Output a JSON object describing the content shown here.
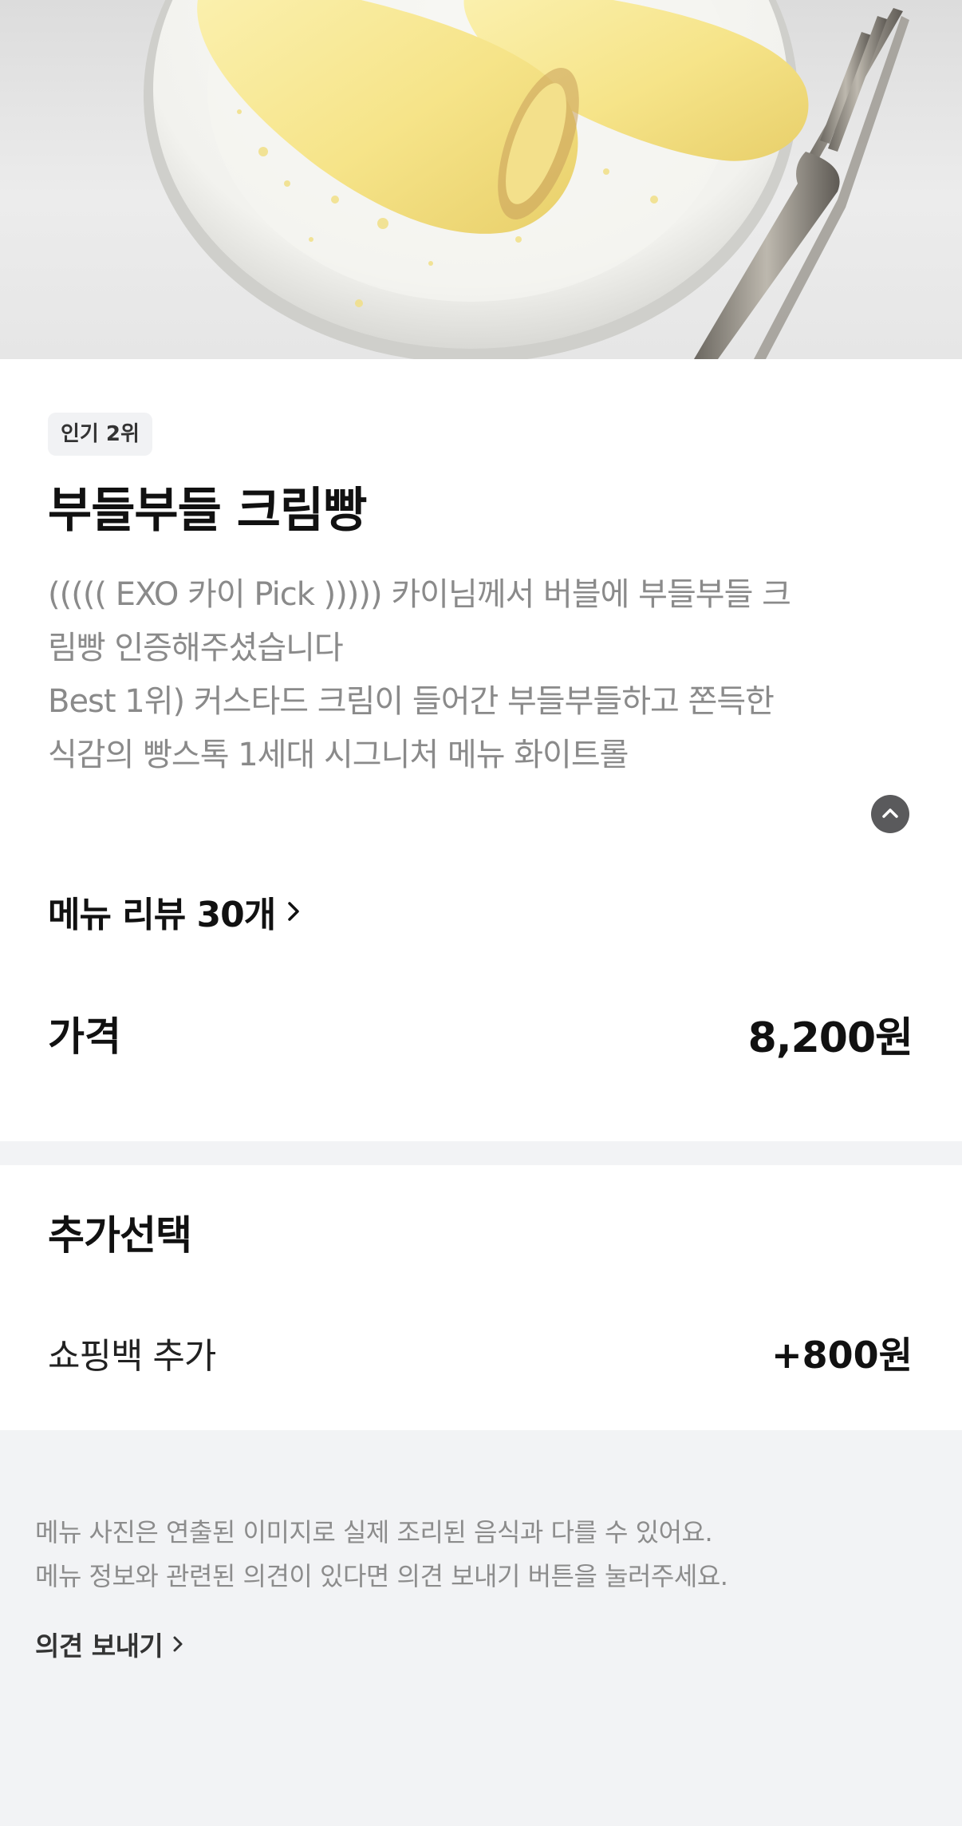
{
  "hero": {
    "image": "cream-bread-photo"
  },
  "menu": {
    "badge": "인기 2위",
    "title": "부들부들 크림빵",
    "description_lines": [
      "((((( EXO 카이 Pick ))))) 카이님께서 버블에 부들부들 크",
      "림빵 인증해주셨습니다",
      "Best 1위) 커스타드 크림이 들어간 부들부들하고 쫀득한",
      "식감의 빵스톡 1세대 시그니처 메뉴 화이트롤"
    ],
    "collapse_icon": "chevron-up-icon",
    "review_link": "메뉴 리뷰 30개",
    "price_label": "가격",
    "price_value": "8,200원"
  },
  "options": {
    "heading": "추가선택",
    "items": [
      {
        "name": "쇼핑백 추가",
        "price": "+800원"
      }
    ]
  },
  "footer": {
    "notice_lines": [
      "메뉴 사진은 연출된 이미지로 실제 조리된 음식과 다를 수 있어요.",
      "메뉴 정보와 관련된 의견이 있다면 의견 보내기 버튼을 눌러주세요."
    ],
    "feedback_link": "의견 보내기"
  },
  "colors": {
    "background": "#f2f3f5",
    "card": "#ffffff",
    "description": "#8a8a8a",
    "badge_bg": "#f1f2f4"
  }
}
